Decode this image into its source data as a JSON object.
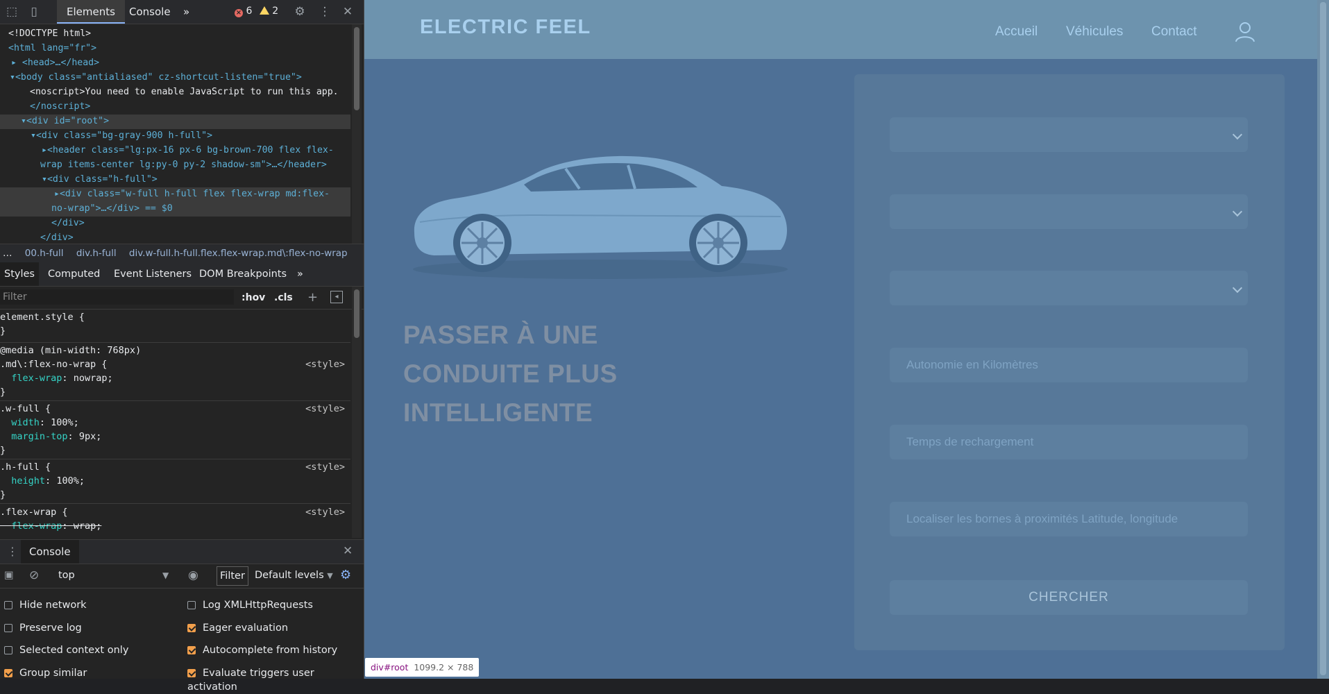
{
  "devtools": {
    "tabs": {
      "elements": "Elements",
      "console": "Console",
      "more": "»"
    },
    "errors": "6",
    "warnings": "2",
    "dom_lines": [
      "<!DOCTYPE html>",
      "<html lang=\"fr\">",
      "<head>…</head>",
      "<body class=\"antialiased\" cz-shortcut-listen=\"true\">",
      "<noscript>You need to enable JavaScript to run this app.",
      "</noscript>",
      "<div id=\"root\">",
      "<div class=\"bg-gray-900 h-full\">",
      "<header class=\"lg:px-16 px-6 bg-brown-700 flex flex-",
      "wrap items-center lg:py-0 py-2 shadow-sm\">…</header>",
      "<div class=\"h-full\">",
      "<div class=\"w-full h-full flex flex-wrap md:flex-",
      "no-wrap\">…</div> == $0",
      "</div>",
      "</div>"
    ],
    "breadcrumbs": [
      "…",
      "00.h-full",
      "div.h-full",
      "div.w-full.h-full.flex.flex-wrap.md\\:flex-no-wrap"
    ],
    "styles_tabs": [
      "Styles",
      "Computed",
      "Event Listeners",
      "DOM Breakpoints",
      "»"
    ],
    "filter_placeholder": "Filter",
    "hov": ":hov",
    "cls": ".cls",
    "rules": {
      "element_style": "element.style {",
      "media": "@media (min-width: 768px)",
      "r1_selector": ".md\\:flex-no-wrap {",
      "r1_prop": "flex-wrap",
      "r1_val": "nowrap;",
      "r2_selector": ".w-full {",
      "r2_prop1": "width",
      "r2_val1": "100%;",
      "r2_prop2": "margin-top",
      "r2_val2": "9px;",
      "r3_selector": ".h-full {",
      "r3_prop": "height",
      "r3_val": "100%;",
      "r4_selector": ".flex-wrap {",
      "r4_prop": "flex-wrap",
      "r4_val": "wrap;",
      "source": "<style>",
      "close": "}"
    },
    "console": {
      "tab": "Console",
      "context": "top",
      "filter": "Filter",
      "levels": "Default levels",
      "options": [
        {
          "label": "Hide network",
          "checked": false
        },
        {
          "label": "Log XMLHttpRequests",
          "checked": false
        },
        {
          "label": "Preserve log",
          "checked": false
        },
        {
          "label": "Eager evaluation",
          "checked": true
        },
        {
          "label": "Selected context only",
          "checked": false
        },
        {
          "label": "Autocomplete from history",
          "checked": true
        },
        {
          "label": "Group similar",
          "checked": true
        },
        {
          "label": "Evaluate triggers user activation",
          "checked": true
        }
      ]
    }
  },
  "site": {
    "logo": "ELECTRIC FEEL",
    "nav": [
      "Accueil",
      "Véhicules",
      "Contact"
    ],
    "hero": [
      "PASSER À UNE",
      "CONDUITE PLUS",
      "INTELLIGENTE"
    ],
    "form": {
      "autonomy_placeholder": "Autonomie en Kilomètres",
      "charge_placeholder": "Temps de rechargement",
      "locate_placeholder": "Localiser les bornes à proximités Latitude, longitude",
      "search_button": "CHERCHER"
    }
  },
  "inspect_tooltip": {
    "tag": "div",
    "id": "#root",
    "size": "1099.2 × 788"
  },
  "colors": {
    "page_bg": "#4e7096",
    "header_bg": "#6d93ae",
    "accent": "#a9d0ee"
  }
}
